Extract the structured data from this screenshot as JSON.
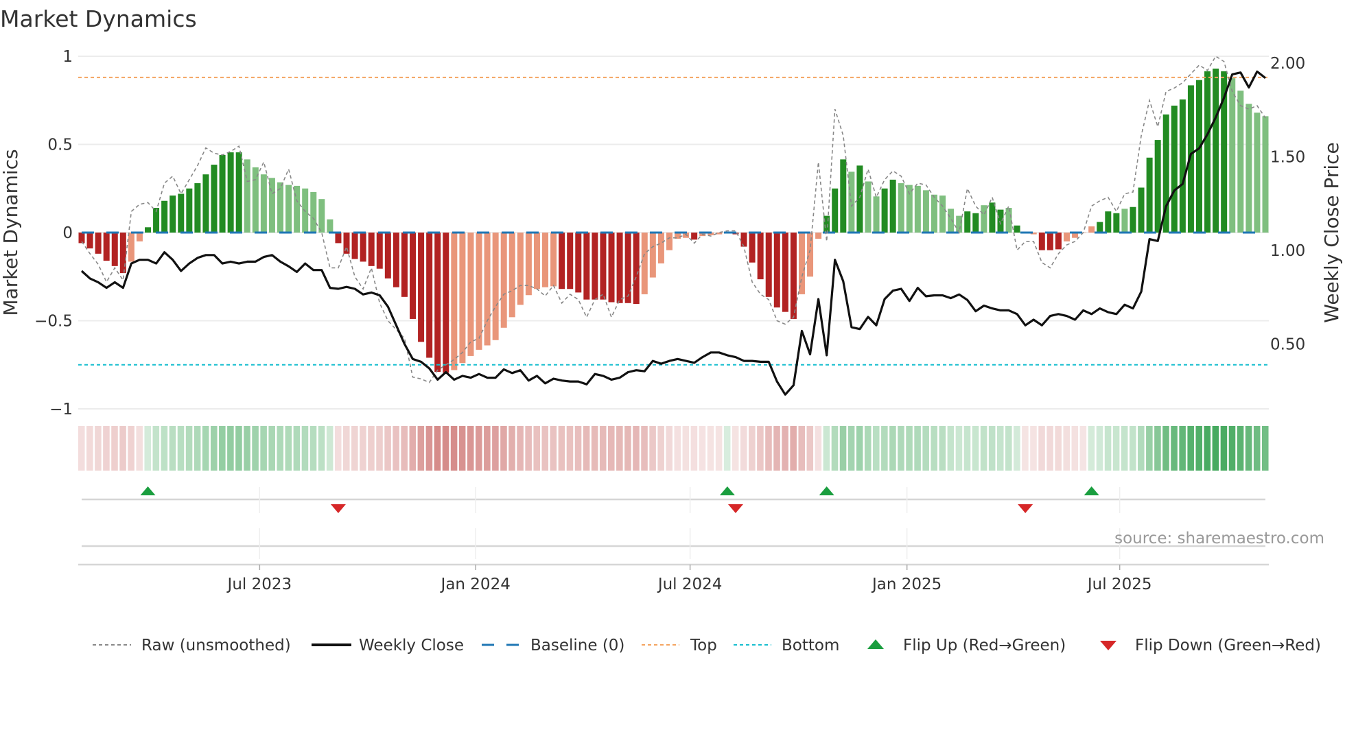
{
  "chart_data": {
    "type": "bar",
    "title": "Market Dynamics",
    "ylabel": "Market Dynamics",
    "y2label": "Weekly Close Price",
    "ylim": [
      -1,
      1
    ],
    "y2lim": [
      0.15,
      2.03
    ],
    "yticks": [
      {
        "v": 1,
        "label": "1"
      },
      {
        "v": 0.5,
        "label": "0.5"
      },
      {
        "v": 0,
        "label": "0"
      },
      {
        "v": -0.5,
        "label": "−0.5"
      },
      {
        "v": -1,
        "label": "−1"
      }
    ],
    "y2ticks": [
      {
        "v": 2.0,
        "label": "2.00"
      },
      {
        "v": 1.5,
        "label": "1.50"
      },
      {
        "v": 1.0,
        "label": "1.00"
      },
      {
        "v": 0.5,
        "label": "0.50"
      }
    ],
    "xticks": [
      {
        "week": 22.5,
        "label": "Jul 2023"
      },
      {
        "week": 48.6,
        "label": "Jan 2024"
      },
      {
        "week": 74.5,
        "label": "Jul 2024"
      },
      {
        "week": 100.7,
        "label": "Jan 2025"
      },
      {
        "week": 126.4,
        "label": "Jul 2025"
      }
    ],
    "top_level": 0.88,
    "bottom_level": -0.75,
    "values": [
      -0.06,
      -0.09,
      -0.12,
      -0.16,
      -0.19,
      -0.23,
      -0.165,
      -0.05,
      0.03,
      0.14,
      0.18,
      0.21,
      0.22,
      0.25,
      0.28,
      0.33,
      0.385,
      0.44,
      0.455,
      0.455,
      0.415,
      0.37,
      0.33,
      0.31,
      0.285,
      0.27,
      0.265,
      0.25,
      0.23,
      0.19,
      0.075,
      -0.06,
      -0.12,
      -0.15,
      -0.165,
      -0.19,
      -0.205,
      -0.26,
      -0.31,
      -0.365,
      -0.49,
      -0.62,
      -0.71,
      -0.79,
      -0.795,
      -0.78,
      -0.74,
      -0.7,
      -0.665,
      -0.64,
      -0.61,
      -0.54,
      -0.48,
      -0.41,
      -0.355,
      -0.32,
      -0.31,
      -0.305,
      -0.32,
      -0.32,
      -0.34,
      -0.38,
      -0.38,
      -0.38,
      -0.395,
      -0.4,
      -0.4,
      -0.405,
      -0.35,
      -0.255,
      -0.175,
      -0.1,
      -0.035,
      -0.03,
      -0.04,
      -0.02,
      -0.015,
      -0.01,
      0.005,
      -0.01,
      -0.08,
      -0.17,
      -0.265,
      -0.365,
      -0.425,
      -0.45,
      -0.49,
      -0.35,
      -0.25,
      -0.035,
      0.095,
      0.25,
      0.415,
      0.345,
      0.38,
      0.29,
      0.205,
      0.25,
      0.3,
      0.28,
      0.27,
      0.265,
      0.24,
      0.215,
      0.21,
      0.135,
      0.095,
      0.12,
      0.11,
      0.155,
      0.17,
      0.13,
      0.14,
      0.04,
      -0.005,
      -0.01,
      -0.1,
      -0.1,
      -0.095,
      -0.05,
      -0.03,
      -0.002,
      0.035,
      0.06,
      0.12,
      0.11,
      0.135,
      0.145,
      0.255,
      0.425,
      0.525,
      0.67,
      0.72,
      0.755,
      0.835,
      0.865,
      0.915,
      0.93,
      0.915,
      0.875,
      0.805,
      0.73,
      0.68,
      0.66
    ],
    "bar_state": "RRRRRRrrGGGGGGGGGGGGgggggggggggRRRRRRRRRRRRRRrrrrrrrrrrrrrRRRRRRRRRRrrrrrrRrrrgRRRRRRRRrrrGGGgGggGGggggggggGGgGGgGgrRRRrrrrGGGgGGGGGGGGGGGGgggggg",
    "state_colors": {
      "R": "#b22222",
      "r": "#e9967a",
      "G": "#228b22",
      "g": "#7fbf7f"
    },
    "raw": [
      -0.05,
      -0.12,
      -0.18,
      -0.28,
      -0.2,
      -0.27,
      0.12,
      0.16,
      0.17,
      0.12,
      0.28,
      0.32,
      0.22,
      0.3,
      0.38,
      0.48,
      0.45,
      0.44,
      0.46,
      0.49,
      0.29,
      0.3,
      0.4,
      0.22,
      0.25,
      0.36,
      0.18,
      0.12,
      0.08,
      0.0,
      -0.2,
      -0.2,
      -0.08,
      -0.25,
      -0.32,
      -0.2,
      -0.4,
      -0.5,
      -0.55,
      -0.6,
      -0.82,
      -0.83,
      -0.85,
      -0.78,
      -0.75,
      -0.72,
      -0.68,
      -0.62,
      -0.6,
      -0.5,
      -0.42,
      -0.35,
      -0.33,
      -0.3,
      -0.3,
      -0.32,
      -0.36,
      -0.3,
      -0.4,
      -0.35,
      -0.38,
      -0.48,
      -0.38,
      -0.35,
      -0.48,
      -0.38,
      -0.36,
      -0.25,
      -0.12,
      -0.08,
      -0.06,
      -0.03,
      -0.03,
      -0.01,
      -0.06,
      -0.01,
      -0.02,
      0.0,
      0.01,
      0.01,
      -0.08,
      -0.28,
      -0.35,
      -0.38,
      -0.5,
      -0.52,
      -0.48,
      -0.25,
      -0.1,
      0.4,
      -0.05,
      0.7,
      0.55,
      0.15,
      0.2,
      0.36,
      0.2,
      0.3,
      0.35,
      0.32,
      0.22,
      0.28,
      0.27,
      0.2,
      0.15,
      0.08,
      0.0,
      0.25,
      0.15,
      0.1,
      0.2,
      0.05,
      0.15,
      -0.1,
      -0.05,
      -0.05,
      -0.17,
      -0.2,
      -0.12,
      -0.07,
      -0.05,
      0.0,
      0.15,
      0.18,
      0.2,
      0.12,
      0.22,
      0.23,
      0.55,
      0.75,
      0.6,
      0.8,
      0.82,
      0.85,
      0.9,
      0.95,
      0.92,
      1.0,
      0.97,
      0.8,
      0.72,
      0.7,
      0.72,
      0.65
    ],
    "close": [
      0.89,
      0.85,
      0.83,
      0.8,
      0.83,
      0.8,
      0.93,
      0.95,
      0.95,
      0.93,
      0.99,
      0.95,
      0.89,
      0.93,
      0.96,
      0.975,
      0.975,
      0.93,
      0.94,
      0.93,
      0.94,
      0.94,
      0.965,
      0.975,
      0.94,
      0.915,
      0.885,
      0.93,
      0.895,
      0.895,
      0.8,
      0.795,
      0.805,
      0.795,
      0.765,
      0.775,
      0.76,
      0.7,
      0.6,
      0.5,
      0.42,
      0.405,
      0.37,
      0.31,
      0.35,
      0.31,
      0.33,
      0.32,
      0.34,
      0.32,
      0.32,
      0.365,
      0.345,
      0.36,
      0.305,
      0.33,
      0.29,
      0.315,
      0.305,
      0.3,
      0.3,
      0.285,
      0.34,
      0.33,
      0.31,
      0.32,
      0.35,
      0.36,
      0.355,
      0.41,
      0.395,
      0.41,
      0.42,
      0.41,
      0.4,
      0.43,
      0.455,
      0.455,
      0.44,
      0.43,
      0.41,
      0.41,
      0.405,
      0.405,
      0.3,
      0.23,
      0.28,
      0.57,
      0.445,
      0.74,
      0.44,
      0.95,
      0.835,
      0.59,
      0.58,
      0.645,
      0.6,
      0.74,
      0.785,
      0.795,
      0.73,
      0.8,
      0.755,
      0.76,
      0.76,
      0.745,
      0.765,
      0.735,
      0.675,
      0.705,
      0.69,
      0.68,
      0.68,
      0.66,
      0.6,
      0.63,
      0.6,
      0.65,
      0.66,
      0.65,
      0.63,
      0.68,
      0.66,
      0.69,
      0.67,
      0.66,
      0.71,
      0.69,
      0.78,
      1.06,
      1.05,
      1.235,
      1.32,
      1.355,
      1.515,
      1.545,
      1.62,
      1.71,
      1.815,
      1.94,
      1.95,
      1.87,
      1.955,
      1.92
    ],
    "flip_up_weeks": [
      9,
      79,
      91,
      123
    ],
    "flip_down_weeks": [
      32,
      80,
      115
    ],
    "legend": [
      {
        "label": "Raw (unsmoothed)"
      },
      {
        "label": "Weekly Close"
      },
      {
        "label": "Baseline (0)"
      },
      {
        "label": "Top"
      },
      {
        "label": "Bottom"
      },
      {
        "label": "Flip Up (Red→Green)"
      },
      {
        "label": "Flip Down (Green→Red)"
      }
    ],
    "colors": {
      "top": "#f4a460",
      "bottom": "#17becf",
      "baseline": "#1f77b4",
      "flip_up": "#1a9e3f",
      "flip_down": "#d62728",
      "raw": "#888888",
      "close": "#111111"
    }
  },
  "source": "source: sharemaestro.com"
}
